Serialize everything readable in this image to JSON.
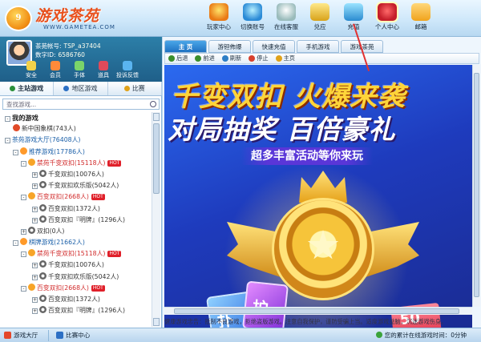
{
  "app": {
    "logo_text": "游戏茶苑",
    "logo_badge": "9",
    "logo_url": "WWW.GAMETEA.COM"
  },
  "toolbar": [
    {
      "label": "玩家中心",
      "icon": "player-center-icon"
    },
    {
      "label": "切换账号",
      "icon": "switch-account-icon"
    },
    {
      "label": "在线客服",
      "icon": "online-service-icon"
    },
    {
      "label": "兑应",
      "icon": "exchange-icon"
    },
    {
      "label": "充值",
      "icon": "recharge-icon"
    },
    {
      "label": "个人中心",
      "icon": "personal-center-icon"
    },
    {
      "label": "邮箱",
      "icon": "mail-icon"
    }
  ],
  "user": {
    "account_label": "茶苑帐号:",
    "account_value": "TSP_a37404",
    "id_label": "数字ID:",
    "id_value": "6586760",
    "quick_icons": [
      "安全",
      "会员",
      "手体",
      "道具",
      "投诉反馈"
    ]
  },
  "left_tabs": [
    "主站游戏",
    "地区游戏",
    "比赛"
  ],
  "search": {
    "placeholder": "查找游戏..."
  },
  "tree": [
    {
      "text": "我的游戏",
      "kind": "bold",
      "level": 0,
      "box": "-"
    },
    {
      "text": "新中国象棋(743人)",
      "kind": "t",
      "level": 1,
      "icon": "gi-mine"
    },
    {
      "text": "茶苑游戏大厅(76408人)",
      "kind": "blue",
      "level": 0,
      "box": "-"
    },
    {
      "text": "推荐游戏(17786人)",
      "kind": "blue",
      "level": 1,
      "box": "-",
      "icon": "gi-cat"
    },
    {
      "text": "禁苑千变双扣(15118人)",
      "kind": "red",
      "level": 2,
      "box": "-",
      "icon": "gi-sun",
      "hot": "HOT"
    },
    {
      "text": "千变双扣(10076人)",
      "kind": "t",
      "level": 3,
      "box": "+",
      "icon": "gi-ball"
    },
    {
      "text": "千变双扣欢乐版(5042人)",
      "kind": "t",
      "level": 3,
      "box": "+",
      "icon": "gi-ball"
    },
    {
      "text": "百变双扣(2668人)",
      "kind": "red",
      "level": 2,
      "box": "-",
      "icon": "gi-sun",
      "hot": "HOT"
    },
    {
      "text": "百变双扣(1372人)",
      "kind": "t",
      "level": 3,
      "box": "+",
      "icon": "gi-ball"
    },
    {
      "text": "百变双扣『明牌』(1296人)",
      "kind": "t",
      "level": 3,
      "box": "+",
      "icon": "gi-ball"
    },
    {
      "text": "双扣(0人)",
      "kind": "t",
      "level": 2,
      "box": "+",
      "icon": "gi-ball"
    },
    {
      "text": "棋牌游戏(21662人)",
      "kind": "blue",
      "level": 1,
      "box": "-",
      "icon": "gi-cat"
    },
    {
      "text": "禁苑千变双扣(15118人)",
      "kind": "red",
      "level": 2,
      "box": "-",
      "icon": "gi-sun",
      "hot": "HOT"
    },
    {
      "text": "千变双扣(10076人)",
      "kind": "t",
      "level": 3,
      "box": "+",
      "icon": "gi-ball"
    },
    {
      "text": "千变双扣欢乐版(5042人)",
      "kind": "t",
      "level": 3,
      "box": "+",
      "icon": "gi-ball"
    },
    {
      "text": "百变双扣(2668人)",
      "kind": "red",
      "level": 2,
      "box": "-",
      "icon": "gi-sun",
      "hot": "HOT"
    },
    {
      "text": "百变双扣(1372人)",
      "kind": "t",
      "level": 3,
      "box": "+",
      "icon": "gi-ball"
    },
    {
      "text": "百变双扣『明牌』(1296人)",
      "kind": "t",
      "level": 3,
      "box": "+",
      "icon": "gi-ball"
    }
  ],
  "right_tabs": [
    "主 页",
    "游钽佈爆",
    "快速充值",
    "手机游戏",
    "游戏茶苑"
  ],
  "nav": [
    {
      "label": "后退",
      "icon": "back-icon"
    },
    {
      "label": "前进",
      "icon": "forward-icon"
    },
    {
      "label": "刷新",
      "icon": "refresh-icon"
    },
    {
      "label": "停止",
      "icon": "stop-icon"
    },
    {
      "label": "主页",
      "icon": "home-icon"
    }
  ],
  "banner": {
    "line1": "千变双扣 火爆来袭",
    "line2": "对局抽奖 百倍豪礼",
    "line3": "超多丰富活动等你来玩",
    "card_a": "扑",
    "card_b": "护",
    "coupon": "50"
  },
  "notice": "健康游戏忠告：抵制不良游戏，拒绝盗版游戏。注意自我保护，谨防受骗上当。适度游戏益脑，沉迷游戏伤身。",
  "status": {
    "btn1": "游戏大厅",
    "btn2": "比赛中心",
    "online_time": "您的累计在线游戏时间：0分钟"
  },
  "colors": {
    "header_bg": "#cfe8fa",
    "userbox_bg": "#2c7fa8",
    "accent_red": "#d12b2b",
    "accent_blue": "#1a5fa8",
    "tab_active": "#1f72c2"
  }
}
